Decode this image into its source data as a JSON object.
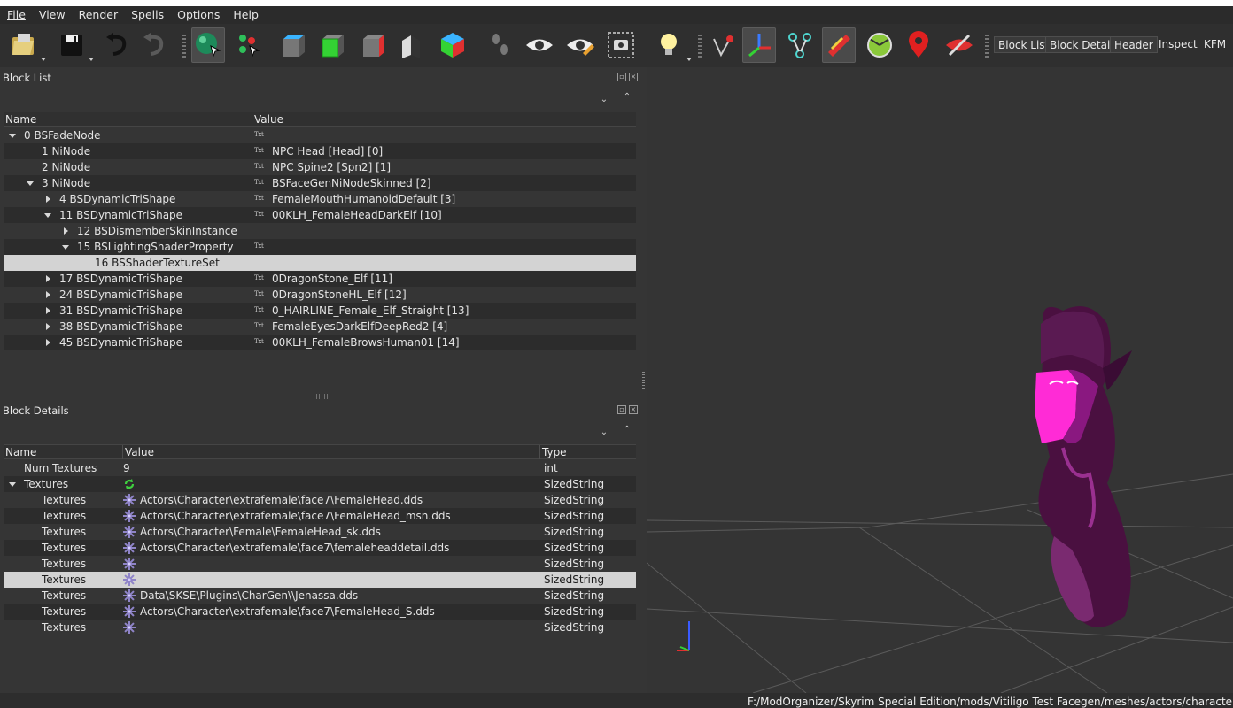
{
  "menu": [
    "File",
    "View",
    "Render",
    "Spells",
    "Options",
    "Help"
  ],
  "toolbar": {
    "icons": [
      "load-icon",
      "save-icon",
      "undo-icon",
      "redo-icon",
      "select-object-icon",
      "select-vertex-icon",
      "view-top-icon",
      "view-front-icon",
      "view-side-icon",
      "view-walk-icon",
      "view-user-icon",
      "walk-icon",
      "show-hidden-icon",
      "show-nodes-icon",
      "screenshot-icon",
      "lighting-icon",
      "node-axes-icon",
      "axes-icon",
      "constraints-icon",
      "furniture-icon",
      "shaders-icon",
      "skinning-icon",
      "markers-icon",
      "hide-marker-icon"
    ],
    "tabs": [
      "Block List",
      "Block Details",
      "Header",
      "Inspect",
      "KFM"
    ]
  },
  "block_list": {
    "title": "Block List",
    "columns": [
      "Name",
      "Value"
    ],
    "rows": [
      {
        "name": "0 BSFadeNode",
        "value": "",
        "txt": true
      },
      {
        "name": "1 NiNode",
        "value": "NPC Head [Head] [0]",
        "txt": true
      },
      {
        "name": "2 NiNode",
        "value": "NPC Spine2 [Spn2] [1]",
        "txt": true
      },
      {
        "name": "3 NiNode",
        "value": "BSFaceGenNiNodeSkinned [2]",
        "txt": true
      },
      {
        "name": "4 BSDynamicTriShape",
        "value": "FemaleMouthHumanoidDefault [3]",
        "txt": true
      },
      {
        "name": "11 BSDynamicTriShape",
        "value": "00KLH_FemaleHeadDarkElf [10]",
        "txt": true
      },
      {
        "name": "12 BSDismemberSkinInstance",
        "value": "",
        "txt": false
      },
      {
        "name": "15 BSLightingShaderProperty",
        "value": "",
        "txt": true
      },
      {
        "name": "16 BSShaderTextureSet",
        "value": "",
        "txt": false
      },
      {
        "name": "17 BSDynamicTriShape",
        "value": "0DragonStone_Elf [11]",
        "txt": true
      },
      {
        "name": "24 BSDynamicTriShape",
        "value": "0DragonStoneHL_Elf [12]",
        "txt": true
      },
      {
        "name": "31 BSDynamicTriShape",
        "value": "0_HAIRLINE_Female_Elf_Straight [13]",
        "txt": true
      },
      {
        "name": "38 BSDynamicTriShape",
        "value": "FemaleEyesDarkElfDeepRed2 [4]",
        "txt": true
      },
      {
        "name": "45 BSDynamicTriShape",
        "value": "00KLH_FemaleBrowsHuman01 [14]",
        "txt": true
      }
    ],
    "txt_label": "Txt"
  },
  "block_details": {
    "title": "Block Details",
    "columns": [
      "Name",
      "Value",
      "Type"
    ],
    "rows": [
      {
        "name": "Num Textures",
        "value": "9",
        "type": "int"
      },
      {
        "name": "Textures",
        "value": "",
        "type": "SizedString"
      },
      {
        "name": "Textures",
        "value": "Actors\\Character\\extrafemale\\face7\\FemaleHead.dds",
        "type": "SizedString"
      },
      {
        "name": "Textures",
        "value": "Actors\\Character\\extrafemale\\face7\\FemaleHead_msn.dds",
        "type": "SizedString"
      },
      {
        "name": "Textures",
        "value": "Actors\\Character\\Female\\FemaleHead_sk.dds",
        "type": "SizedString"
      },
      {
        "name": "Textures",
        "value": "Actors\\Character\\extrafemale\\face7\\femaleheaddetail.dds",
        "type": "SizedString"
      },
      {
        "name": "Textures",
        "value": "",
        "type": "SizedString"
      },
      {
        "name": "Textures",
        "value": "",
        "type": "SizedString"
      },
      {
        "name": "Textures",
        "value": "Data\\SKSE\\Plugins\\CharGen\\\\Jenassa.dds",
        "type": "SizedString"
      },
      {
        "name": "Textures",
        "value": "Actors\\Character\\extrafemale\\face7\\FemaleHead_S.dds",
        "type": "SizedString"
      },
      {
        "name": "Textures",
        "value": "",
        "type": "SizedString"
      }
    ]
  },
  "status": {
    "path": "F:/ModOrganizer/Skyrim Special Edition/mods/Vitiligo Test Facegen/meshes/actors/character"
  },
  "colors": {
    "accent_magenta": "#ff2bd6",
    "background": "#353535",
    "selection": "#d3d3d3"
  }
}
